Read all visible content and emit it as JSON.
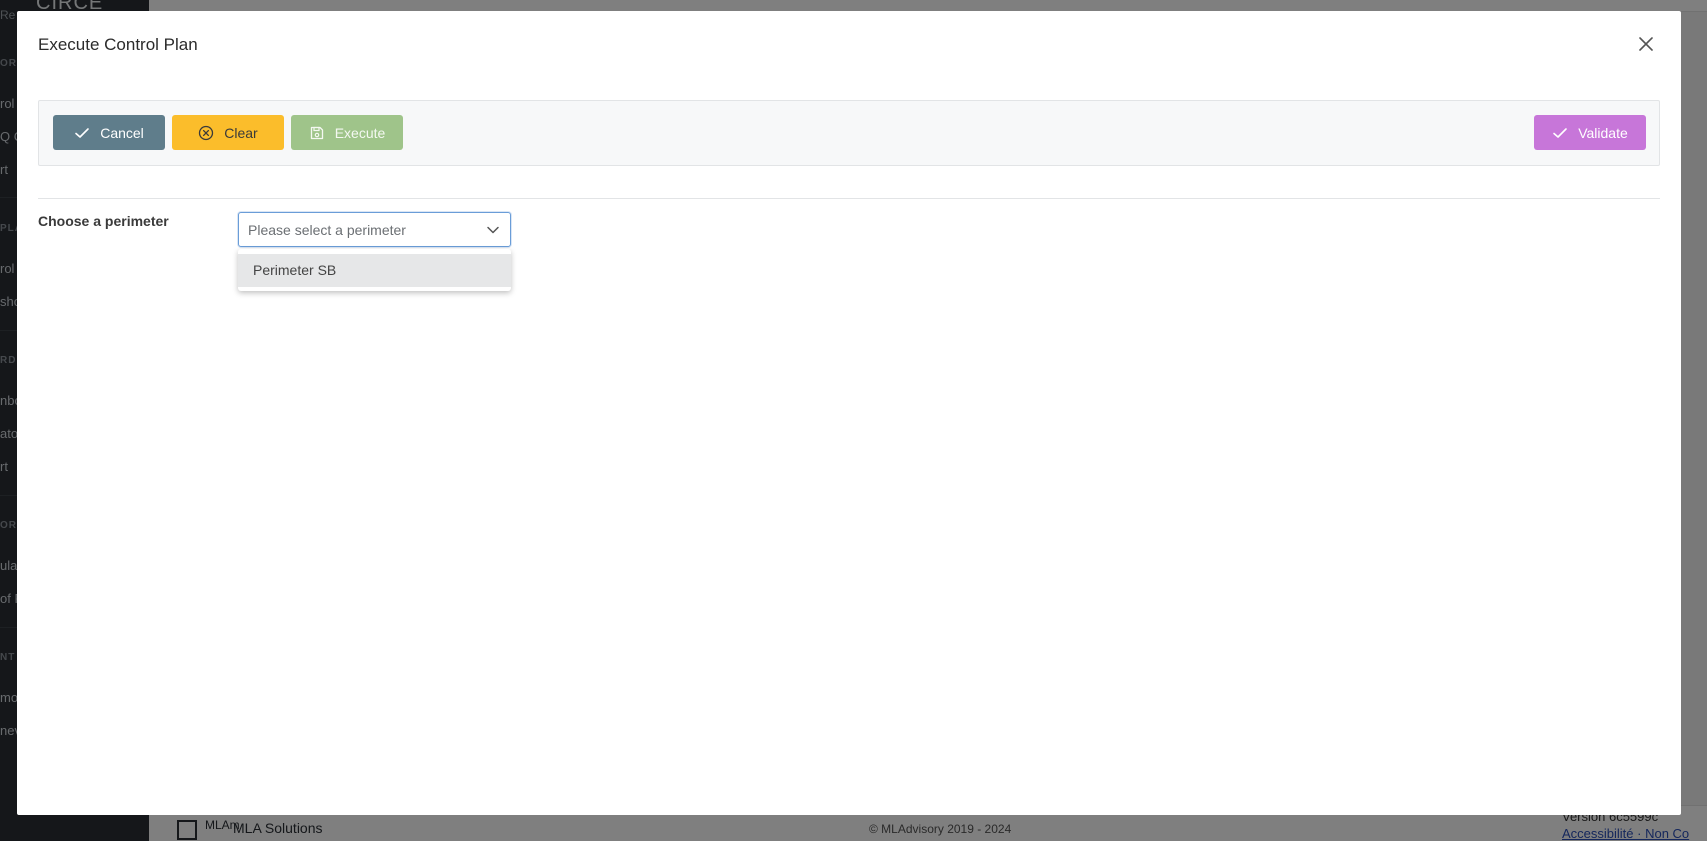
{
  "background": {
    "sidebar": {
      "brand": "CIRCE",
      "brand_sub": "Re",
      "items": [
        {
          "kind": "section",
          "text": "ORY"
        },
        {
          "kind": "item",
          "text": "rol"
        },
        {
          "kind": "item",
          "text": "Q C"
        },
        {
          "kind": "item",
          "text": "rt"
        },
        {
          "kind": "section",
          "text": "PLA"
        },
        {
          "kind": "item",
          "text": "rol"
        },
        {
          "kind": "item",
          "text": "sho"
        },
        {
          "kind": "section",
          "text": "RD"
        },
        {
          "kind": "item",
          "text": "nbo"
        },
        {
          "kind": "item",
          "text": "ato"
        },
        {
          "kind": "item",
          "text": "rt"
        },
        {
          "kind": "section",
          "text": "ORY"
        },
        {
          "kind": "item",
          "text": "ulat"
        },
        {
          "kind": "item",
          "text": "of F"
        },
        {
          "kind": "section",
          "text": "NT"
        },
        {
          "kind": "item",
          "text": "mo"
        },
        {
          "kind": "item",
          "text": "nev"
        }
      ]
    },
    "footer": {
      "logo_mark": "MLAm",
      "company": "MLA Solutions",
      "copyright": "© MLAdvisory 2019 - 2024",
      "version": "Version 6c5599c",
      "links": "Accessibilité · Non Co"
    }
  },
  "modal": {
    "title": "Execute Control Plan",
    "toolbar": {
      "cancel_label": "Cancel",
      "clear_label": "Clear",
      "execute_label": "Execute",
      "validate_label": "Validate"
    },
    "form": {
      "perimeter_label": "Choose a perimeter",
      "perimeter_placeholder": "Please select a perimeter",
      "perimeter_options": [
        "Perimeter SB"
      ]
    }
  },
  "colors": {
    "cancel": "#5f7d8b",
    "clear": "#fbbd2b",
    "execute": "#9fc48a",
    "validate": "#c776d9",
    "select_focus": "#6a9dd8"
  }
}
